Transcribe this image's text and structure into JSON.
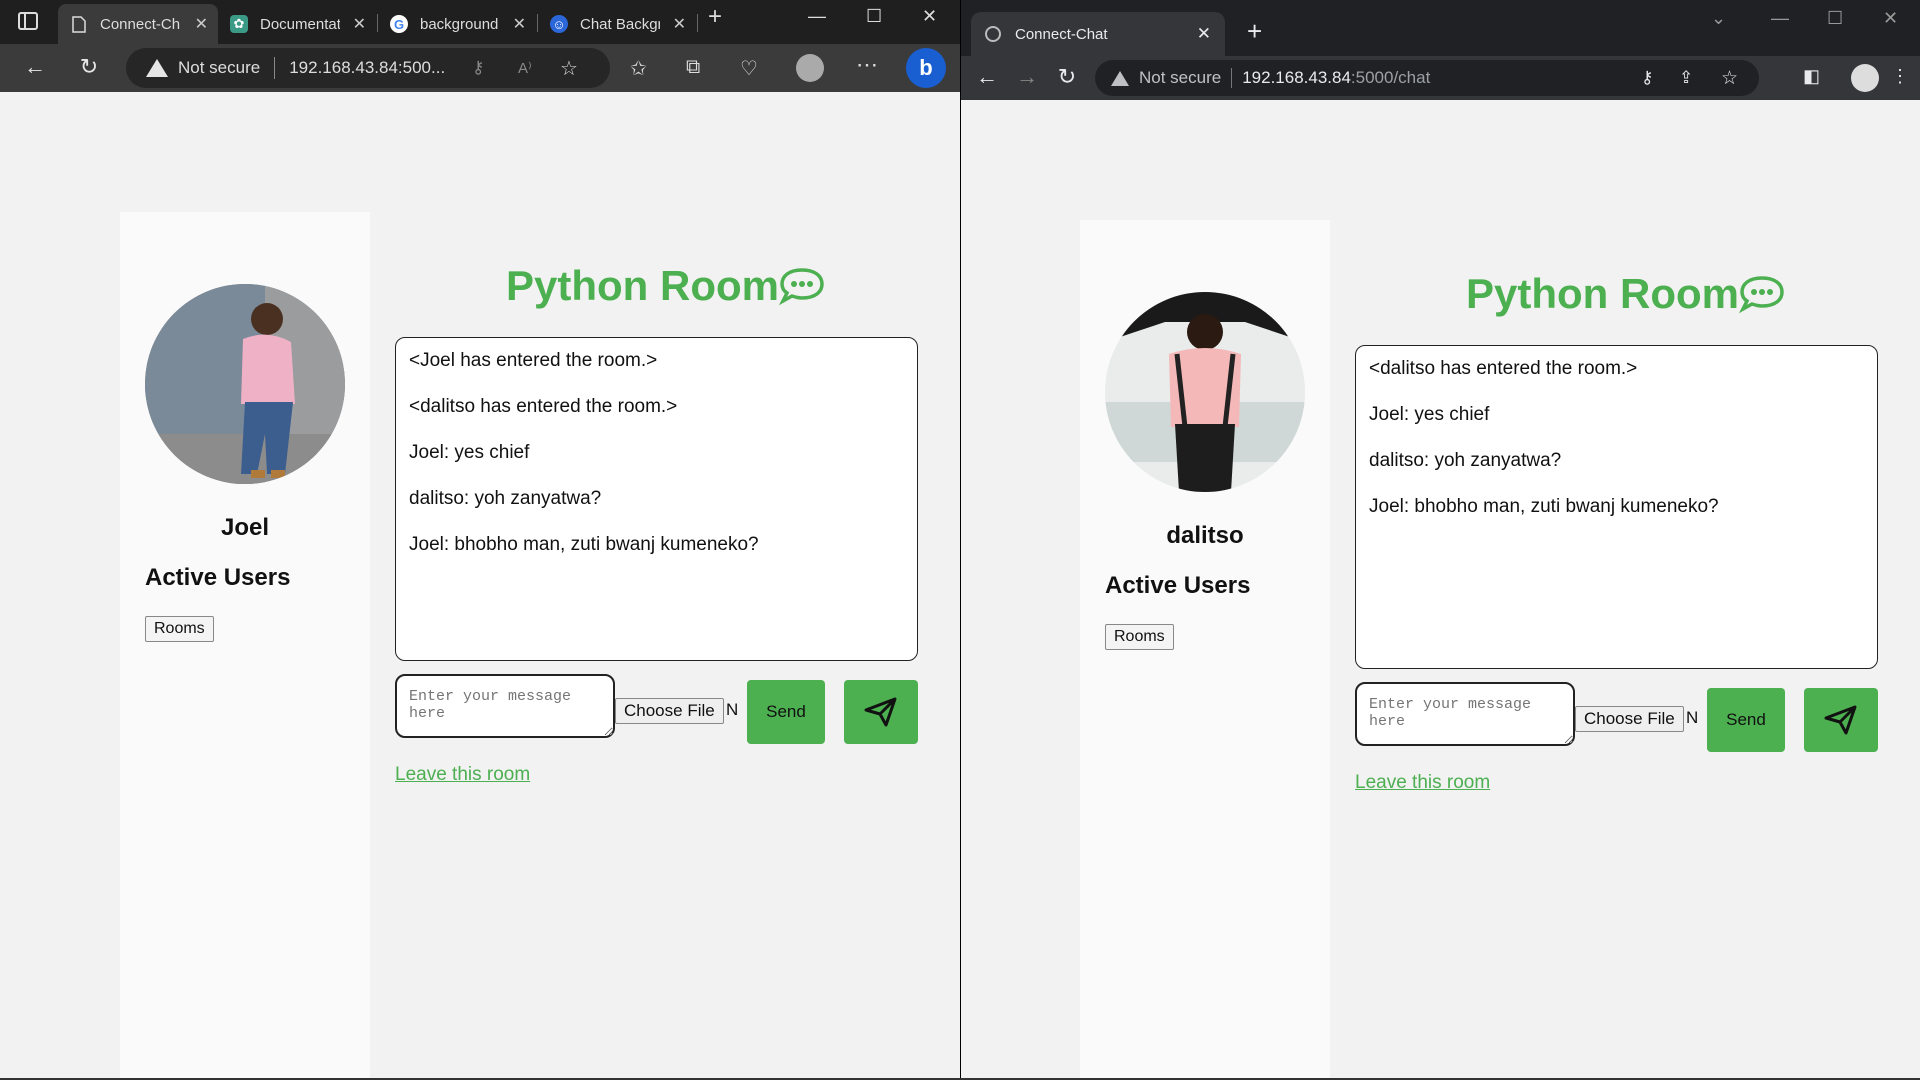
{
  "left_window": {
    "tabs": [
      {
        "title": "Connect-Chat",
        "active": true,
        "favicon": "page-icon"
      },
      {
        "title": "Documentation",
        "active": false,
        "favicon": "chatgpt-icon"
      },
      {
        "title": "background",
        "active": false,
        "favicon": "google-icon"
      },
      {
        "title": "Chat Background",
        "active": false,
        "favicon": "bot-icon"
      }
    ],
    "security_label": "Not secure",
    "url": "192.168.43.84:500...",
    "user": {
      "name": "Joel"
    },
    "messages": [
      "<Joel has entered the room.>",
      "<dalitso has entered the room.>",
      "Joel: yes chief",
      "dalitso: yoh zanyatwa?",
      "Joel: bhobho man, zuti bwanj kumeneko?"
    ]
  },
  "right_window": {
    "tabs": [
      {
        "title": "Connect-Chat",
        "active": true,
        "favicon": "globe-icon"
      }
    ],
    "security_label": "Not secure",
    "url_host": "192.168.43.84",
    "url_path": ":5000/chat",
    "user": {
      "name": "dalitso"
    },
    "messages": [
      "<dalitso has entered the room.>",
      "Joel: yes chief",
      "dalitso: yoh zanyatwa?",
      "Joel: bhobho man, zuti bwanj kumeneko?"
    ]
  },
  "page": {
    "room_title": "Python Room",
    "active_users_heading": "Active Users",
    "rooms_button": "Rooms",
    "message_placeholder": "Enter your message here",
    "choose_file_label": "Choose File",
    "choose_file_tail": "N",
    "send_label": "Send",
    "leave_link": "Leave this room"
  },
  "colors": {
    "accent": "#4caf50",
    "edge_frame": "#1f1f1f",
    "chrome_frame": "#202124"
  }
}
